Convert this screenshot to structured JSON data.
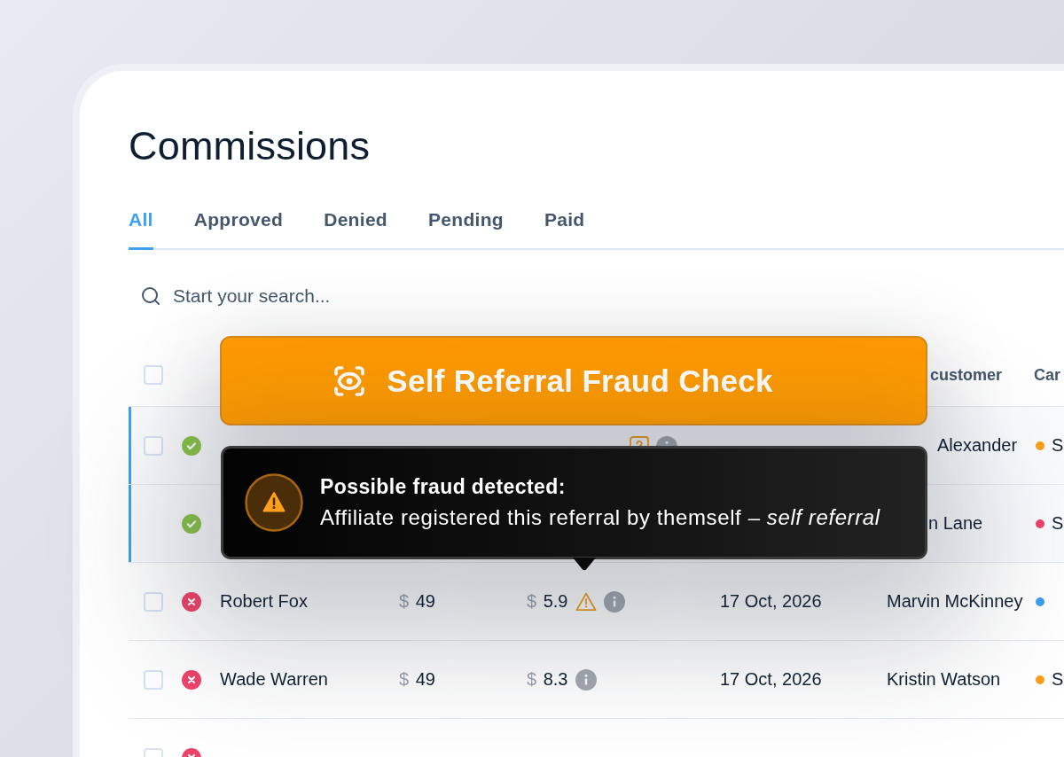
{
  "page": {
    "title": "Commissions"
  },
  "tabs": [
    {
      "label": "All",
      "selected": true
    },
    {
      "label": "Approved",
      "selected": false
    },
    {
      "label": "Denied",
      "selected": false
    },
    {
      "label": "Pending",
      "selected": false
    },
    {
      "label": "Paid",
      "selected": false
    }
  ],
  "search": {
    "placeholder": "Start your search..."
  },
  "table": {
    "header_checkbox": {
      "checked": false
    },
    "columns": [
      {
        "label": "customer"
      },
      {
        "label": "Car"
      }
    ],
    "rows": [
      {
        "kind": "covered_entry",
        "checked": false,
        "selected": true,
        "approved": true,
        "commission": {
          "icons": [
            {
              "kind": "review"
            },
            {
              "kind": "info"
            }
          ]
        },
        "customer": "Alexander",
        "campaign": {
          "label": "S",
          "color": "#ff9f1c"
        }
      },
      {
        "kind": "sub",
        "selected": true,
        "approved": true,
        "customer": "n Lane",
        "campaign": {
          "label": "S",
          "color": "#f0436a"
        }
      },
      {
        "kind": "entry",
        "checked": false,
        "selected": false,
        "approved": false,
        "name": "Robert Fox",
        "amount": {
          "currency": "$",
          "value": "49"
        },
        "commission": {
          "currency": "$",
          "value": "5.9",
          "icons": [
            {
              "kind": "warning"
            },
            {
              "kind": "info"
            }
          ]
        },
        "date": "17 Oct, 2026",
        "customer": "Marvin McKinney",
        "campaign": {
          "color": "#3ea0f0"
        }
      },
      {
        "kind": "entry",
        "checked": false,
        "selected": false,
        "approved": false,
        "name": "Wade Warren",
        "amount": {
          "currency": "$",
          "value": "49"
        },
        "commission": {
          "currency": "$",
          "value": "8.3",
          "icons": [
            {
              "kind": "info"
            }
          ]
        },
        "date": "17 Oct, 2026",
        "customer": "Kristin Watson",
        "campaign": {
          "label": "S",
          "color": "#ff9f1c"
        }
      },
      {
        "kind": "entry",
        "checked": false,
        "selected": false,
        "approved": false
      }
    ]
  },
  "banner": {
    "title": "Self Referral Fraud Check"
  },
  "alert": {
    "title": "Possible fraud detected:",
    "message": "Affiliate registered this referral by themself *– self referral*"
  }
}
